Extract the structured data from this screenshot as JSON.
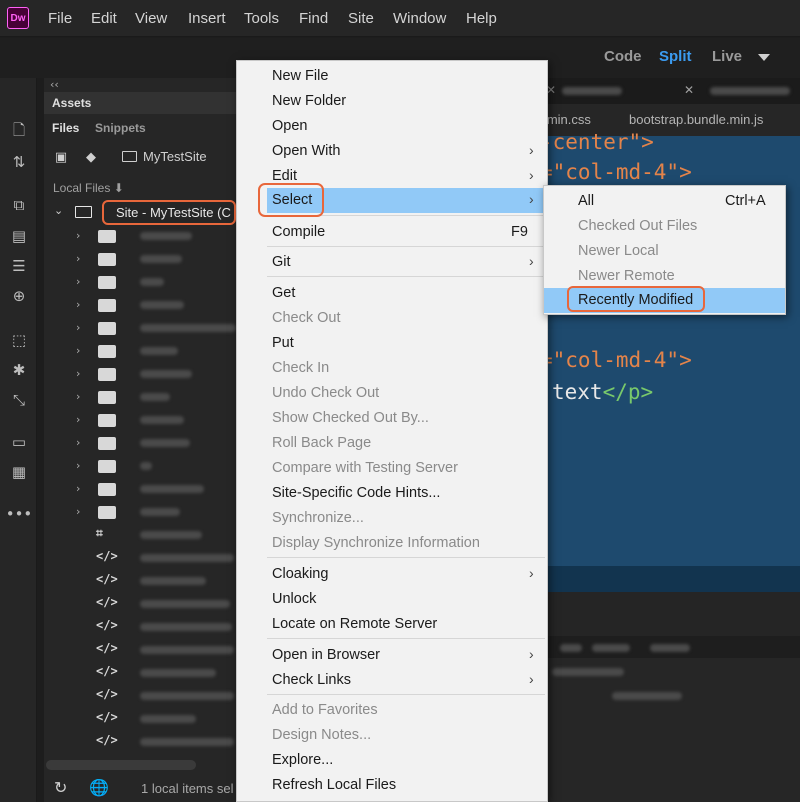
{
  "app": {
    "logo_text": "Dw",
    "accent": "#ff61f6"
  },
  "menubar": {
    "items": [
      "File",
      "Edit",
      "View",
      "Insert",
      "Tools",
      "Find",
      "Site",
      "Window",
      "Help"
    ]
  },
  "toolbar": {
    "code": "Code",
    "split": "Split",
    "live": "Live",
    "split_color": "#3b9bf0"
  },
  "rail": {
    "icons": [
      "file-icon",
      "arrows-updown-icon",
      "code-icon",
      "properties-icon",
      "css-designer-icon",
      "insert-icon",
      "dom-icon",
      "asset-icon",
      "behaviors-icon",
      "comment-icon",
      "snippet-icon",
      "more-icon"
    ]
  },
  "files_panel": {
    "collapse": "‹‹",
    "assets": "Assets",
    "tab_files": "Files",
    "tab_snippets": "Snippets",
    "site_name": "MyTestSite",
    "local_files": "Local Files",
    "root_label": "Site - MyTestSite (C",
    "status": "1 local items sel",
    "highlight_color": "#e8673b"
  },
  "editor": {
    "related_files": [
      "p.min.css",
      "bootstrap.bundle.min.js"
    ],
    "code": {
      "line1": "-center\">",
      "line2_str": "=\"col-md-4\">",
      "line3_str": "=\"col-md-4\">",
      "line4_text": "text",
      "line4_tag": "</p>"
    },
    "bg": "#1e4a6e"
  },
  "context_menu": {
    "new_file": "New File",
    "new_folder": "New Folder",
    "open": "Open",
    "open_with": "Open With",
    "edit": "Edit",
    "select": "Select",
    "compile": "Compile",
    "compile_shortcut": "F9",
    "git": "Git",
    "get": "Get",
    "check_out": "Check Out",
    "put": "Put",
    "check_in": "Check In",
    "undo_check_out": "Undo Check Out",
    "show_checked_out_by": "Show Checked Out By...",
    "roll_back_page": "Roll Back Page",
    "compare_with_testing_server": "Compare with Testing Server",
    "site_specific_code_hints": "Site-Specific Code Hints...",
    "synchronize": "Synchronize...",
    "display_synchronize_information": "Display Synchronize Information",
    "cloaking": "Cloaking",
    "unlock": "Unlock",
    "locate_on_remote_server": "Locate on Remote Server",
    "open_in_browser": "Open in Browser",
    "check_links": "Check Links",
    "add_to_favorites": "Add to Favorites",
    "design_notes": "Design Notes...",
    "explore": "Explore...",
    "refresh_local_files": "Refresh Local Files",
    "highlight_color": "#91c9f7"
  },
  "submenu": {
    "all": "All",
    "all_shortcut": "Ctrl+A",
    "checked_out_files": "Checked Out Files",
    "newer_local": "Newer Local",
    "newer_remote": "Newer Remote",
    "recently_modified": "Recently Modified"
  }
}
